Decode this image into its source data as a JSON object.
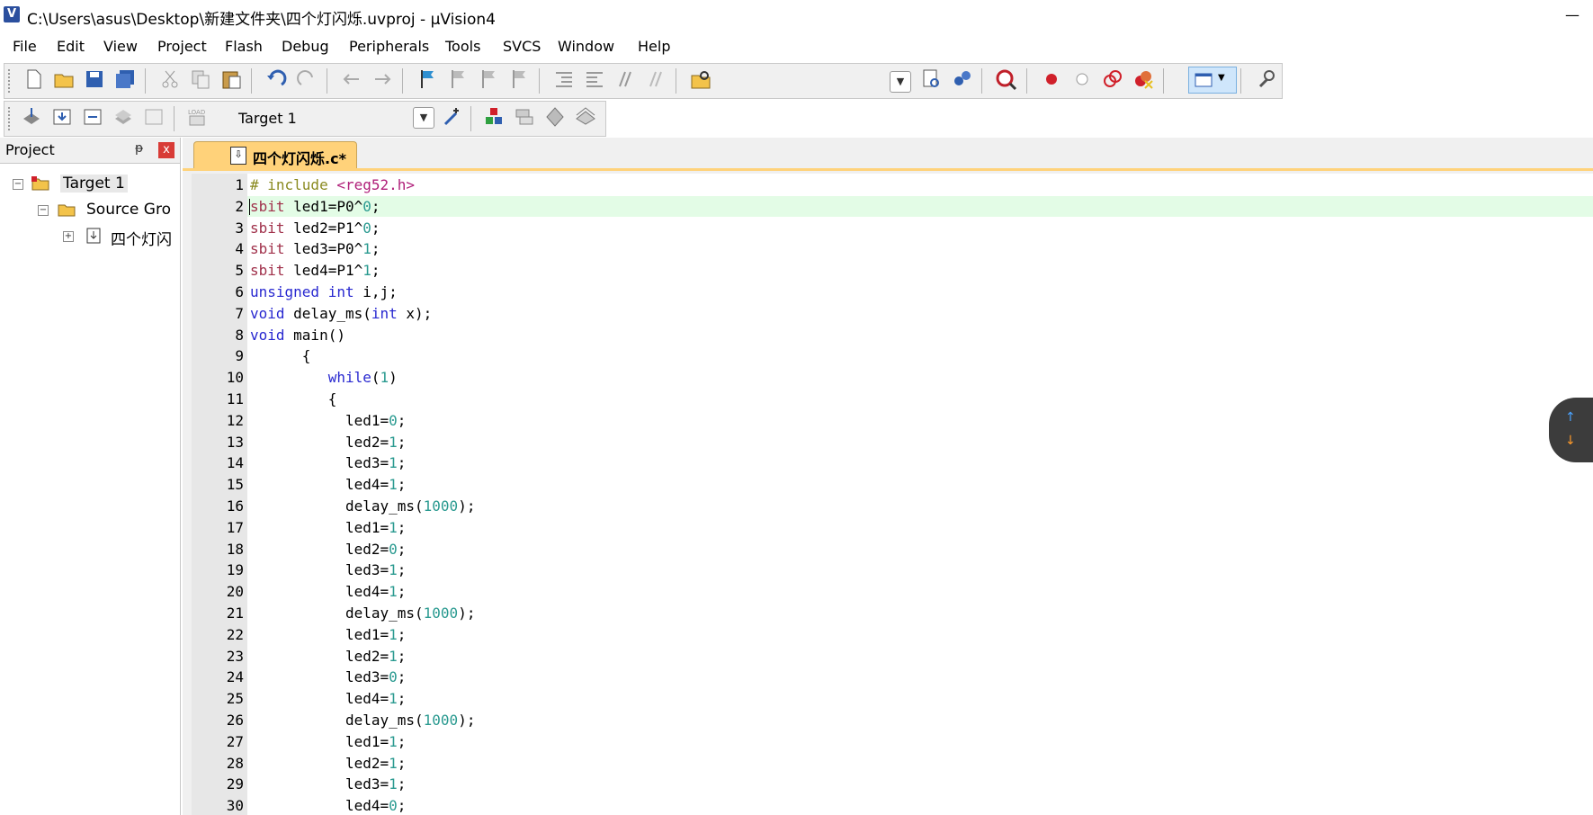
{
  "window": {
    "title": "C:\\Users\\asus\\Desktop\\新建文件夹\\四个灯闪烁.uvproj - µVision4",
    "app_icon_glyph": "V",
    "minimize_glyph": "—"
  },
  "menu": [
    "File",
    "Edit",
    "View",
    "Project",
    "Flash",
    "Debug",
    "Peripherals",
    "Tools",
    "SVCS",
    "Window",
    "Help"
  ],
  "build_toolbar": {
    "target": "Target 1",
    "dropdown_glyph": "▼"
  },
  "project_panel": {
    "title": "Project",
    "pin_glyph": "ᵽ",
    "close_glyph": "x",
    "tree": {
      "target": "Target 1",
      "group": "Source Gro",
      "file": "四个灯闪"
    },
    "collapse_glyph": "−",
    "expand_glyph": "+"
  },
  "editor": {
    "tab_label": "四个灯闪烁.c*",
    "lines": [
      {
        "n": "1",
        "parts": [
          {
            "t": "# include ",
            "c": "pp"
          },
          {
            "t": "<reg52.h>",
            "c": "inc"
          }
        ]
      },
      {
        "n": "2",
        "parts": [
          {
            "t": "sbit",
            "c": "kw-red"
          },
          {
            "t": " led1=P0^",
            "c": ""
          },
          {
            "t": "0",
            "c": "num"
          },
          {
            "t": ";",
            "c": ""
          }
        ]
      },
      {
        "n": "3",
        "parts": [
          {
            "t": "sbit",
            "c": "kw-red"
          },
          {
            "t": " led2=P1^",
            "c": ""
          },
          {
            "t": "0",
            "c": "num"
          },
          {
            "t": ";",
            "c": ""
          }
        ]
      },
      {
        "n": "4",
        "parts": [
          {
            "t": "sbit",
            "c": "kw-red"
          },
          {
            "t": " led3=P0^",
            "c": ""
          },
          {
            "t": "1",
            "c": "num"
          },
          {
            "t": ";",
            "c": ""
          }
        ]
      },
      {
        "n": "5",
        "parts": [
          {
            "t": "sbit",
            "c": "kw-red"
          },
          {
            "t": " led4=P1^",
            "c": ""
          },
          {
            "t": "1",
            "c": "num"
          },
          {
            "t": ";",
            "c": ""
          }
        ]
      },
      {
        "n": "6",
        "parts": [
          {
            "t": "unsigned",
            "c": "kw-blue"
          },
          {
            "t": " ",
            "c": ""
          },
          {
            "t": "int",
            "c": "kw-blue"
          },
          {
            "t": " i,j;",
            "c": ""
          }
        ]
      },
      {
        "n": "7",
        "parts": [
          {
            "t": "void",
            "c": "kw-blue"
          },
          {
            "t": " delay_ms(",
            "c": ""
          },
          {
            "t": "int",
            "c": "kw-blue"
          },
          {
            "t": " x);",
            "c": ""
          }
        ]
      },
      {
        "n": "8",
        "parts": [
          {
            "t": "void",
            "c": "kw-blue"
          },
          {
            "t": " main()",
            "c": ""
          }
        ]
      },
      {
        "n": "9",
        "parts": [
          {
            "t": "      {",
            "c": ""
          }
        ]
      },
      {
        "n": "10",
        "parts": [
          {
            "t": "         ",
            "c": ""
          },
          {
            "t": "while",
            "c": "kw-blue"
          },
          {
            "t": "(",
            "c": ""
          },
          {
            "t": "1",
            "c": "num"
          },
          {
            "t": ")",
            "c": ""
          }
        ]
      },
      {
        "n": "11",
        "parts": [
          {
            "t": "         {",
            "c": ""
          }
        ]
      },
      {
        "n": "12",
        "parts": [
          {
            "t": "           led1=",
            "c": ""
          },
          {
            "t": "0",
            "c": "num"
          },
          {
            "t": ";",
            "c": ""
          }
        ]
      },
      {
        "n": "13",
        "parts": [
          {
            "t": "           led2=",
            "c": ""
          },
          {
            "t": "1",
            "c": "num"
          },
          {
            "t": ";",
            "c": ""
          }
        ]
      },
      {
        "n": "14",
        "parts": [
          {
            "t": "           led3=",
            "c": ""
          },
          {
            "t": "1",
            "c": "num"
          },
          {
            "t": ";",
            "c": ""
          }
        ]
      },
      {
        "n": "15",
        "parts": [
          {
            "t": "           led4=",
            "c": ""
          },
          {
            "t": "1",
            "c": "num"
          },
          {
            "t": ";",
            "c": ""
          }
        ]
      },
      {
        "n": "16",
        "parts": [
          {
            "t": "           delay_ms(",
            "c": ""
          },
          {
            "t": "1000",
            "c": "num"
          },
          {
            "t": ");",
            "c": ""
          }
        ]
      },
      {
        "n": "17",
        "parts": [
          {
            "t": "           led1=",
            "c": ""
          },
          {
            "t": "1",
            "c": "num"
          },
          {
            "t": ";",
            "c": ""
          }
        ]
      },
      {
        "n": "18",
        "parts": [
          {
            "t": "           led2=",
            "c": ""
          },
          {
            "t": "0",
            "c": "num"
          },
          {
            "t": ";",
            "c": ""
          }
        ]
      },
      {
        "n": "19",
        "parts": [
          {
            "t": "           led3=",
            "c": ""
          },
          {
            "t": "1",
            "c": "num"
          },
          {
            "t": ";",
            "c": ""
          }
        ]
      },
      {
        "n": "20",
        "parts": [
          {
            "t": "           led4=",
            "c": ""
          },
          {
            "t": "1",
            "c": "num"
          },
          {
            "t": ";",
            "c": ""
          }
        ]
      },
      {
        "n": "21",
        "parts": [
          {
            "t": "           delay_ms(",
            "c": ""
          },
          {
            "t": "1000",
            "c": "num"
          },
          {
            "t": ");",
            "c": ""
          }
        ]
      },
      {
        "n": "22",
        "parts": [
          {
            "t": "           led1=",
            "c": ""
          },
          {
            "t": "1",
            "c": "num"
          },
          {
            "t": ";",
            "c": ""
          }
        ]
      },
      {
        "n": "23",
        "parts": [
          {
            "t": "           led2=",
            "c": ""
          },
          {
            "t": "1",
            "c": "num"
          },
          {
            "t": ";",
            "c": ""
          }
        ]
      },
      {
        "n": "24",
        "parts": [
          {
            "t": "           led3=",
            "c": ""
          },
          {
            "t": "0",
            "c": "num"
          },
          {
            "t": ";",
            "c": ""
          }
        ]
      },
      {
        "n": "25",
        "parts": [
          {
            "t": "           led4=",
            "c": ""
          },
          {
            "t": "1",
            "c": "num"
          },
          {
            "t": ";",
            "c": ""
          }
        ]
      },
      {
        "n": "26",
        "parts": [
          {
            "t": "           delay_ms(",
            "c": ""
          },
          {
            "t": "1000",
            "c": "num"
          },
          {
            "t": ");",
            "c": ""
          }
        ]
      },
      {
        "n": "27",
        "parts": [
          {
            "t": "           led1=",
            "c": ""
          },
          {
            "t": "1",
            "c": "num"
          },
          {
            "t": ";",
            "c": ""
          }
        ]
      },
      {
        "n": "28",
        "parts": [
          {
            "t": "           led2=",
            "c": ""
          },
          {
            "t": "1",
            "c": "num"
          },
          {
            "t": ";",
            "c": ""
          }
        ]
      },
      {
        "n": "29",
        "parts": [
          {
            "t": "           led3=",
            "c": ""
          },
          {
            "t": "1",
            "c": "num"
          },
          {
            "t": ";",
            "c": ""
          }
        ]
      },
      {
        "n": "30",
        "parts": [
          {
            "t": "           led4=",
            "c": ""
          },
          {
            "t": "0",
            "c": "num"
          },
          {
            "t": ";",
            "c": ""
          }
        ]
      }
    ]
  },
  "scroll_widget": {
    "up_glyph": "↑",
    "down_glyph": "↓"
  },
  "colors": {
    "tab_active": "#ffd27a",
    "current_line": "#e3fce6",
    "keyword_blue": "#2828d0",
    "keyword_red": "#a0304a",
    "number": "#2a9a90"
  }
}
